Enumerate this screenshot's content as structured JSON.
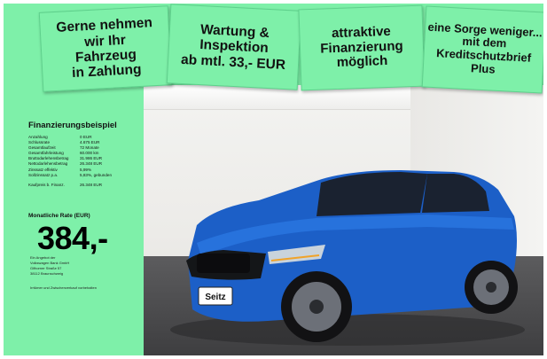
{
  "stickers": [
    {
      "text": "Gerne nehmen\nwir Ihr\nFahrzeug\nin Zahlung"
    },
    {
      "text": "Wartung &\nInspektion\nab mtl. 33,- EUR"
    },
    {
      "text": "attraktive\nFinanzierung\nmöglich"
    },
    {
      "text": "eine Sorge weniger...\nmit dem\nKreditschutzbrief\nPlus"
    }
  ],
  "financing": {
    "title": "Finanzierungsbeispiel",
    "rows": [
      {
        "label": "Anzahlung",
        "value": "0 EUR"
      },
      {
        "label": "Schlussrate",
        "value": "4.675 EUR"
      },
      {
        "label": "Gesamtlaufzeit",
        "value": "72 Monate"
      },
      {
        "label": "Gesamtfahrleistung",
        "value": "60.000 km"
      },
      {
        "label": "Bruttodarlehensbetrag",
        "value": "31.986 EUR"
      },
      {
        "label": "Nettodarlehensbetrag",
        "value": "26.348 EUR"
      },
      {
        "label": "Zinssatz effektiv",
        "value": "5,99%"
      },
      {
        "label": "Sollzinssatz p.a.",
        "value": "5,83%, gebunden"
      }
    ],
    "price": {
      "label": "Kaufpreis b. Finanz.",
      "value": "26.348 EUR"
    },
    "rate_label": "Monatliche Rate (EUR)",
    "rate_value": "384,-",
    "offer_lines": [
      "Ein Angebot der",
      "Volkswagen Bank GmbH",
      "Gifhorner Straße 57",
      "38112 Braunschweig"
    ],
    "disclaimer": "Irrtümer und Zwischenverkauf vorbehalten"
  },
  "plate": {
    "text": "Seitz"
  },
  "colors": {
    "accent_green": "#7ef0a9",
    "car_blue": "#1c5fc7"
  }
}
